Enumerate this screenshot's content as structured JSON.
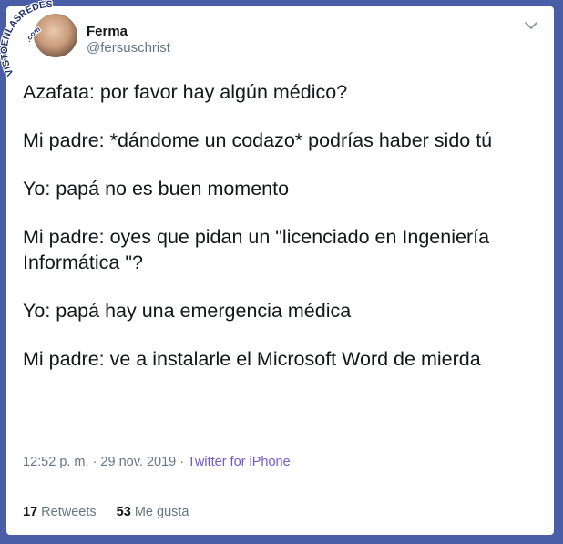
{
  "watermark": {
    "text_main": "VISTOENLASREDES",
    "text_sub": ".com",
    "color": "#1d2f6a"
  },
  "tweet": {
    "author_name": "Ferma",
    "author_handle": "@fersuschrist",
    "lines": [
      "Azafata: por favor hay algún médico?",
      "Mi padre: *dándome un codazo* podrías haber sido tú",
      "Yo: papá no es buen momento",
      "Mi padre: oyes que pidan un \"licenciado en Ingeniería Informática \"?",
      "Yo: papá hay una emergencia médica",
      "Mi padre: ve a instalarle el Microsoft Word de mierda"
    ],
    "timestamp": "12:52 p. m. · 29 nov. 2019 · ",
    "source": "Twitter for iPhone",
    "retweets_count": "17",
    "retweets_label": "Retweets",
    "likes_count": "53",
    "likes_label": "Me gusta"
  },
  "icons": {
    "caret": "chevron-down-icon"
  },
  "colors": {
    "background_frame": "#4a5ea8",
    "text_primary": "#14171a",
    "text_secondary": "#657786",
    "source_link": "#6e5bd0"
  }
}
